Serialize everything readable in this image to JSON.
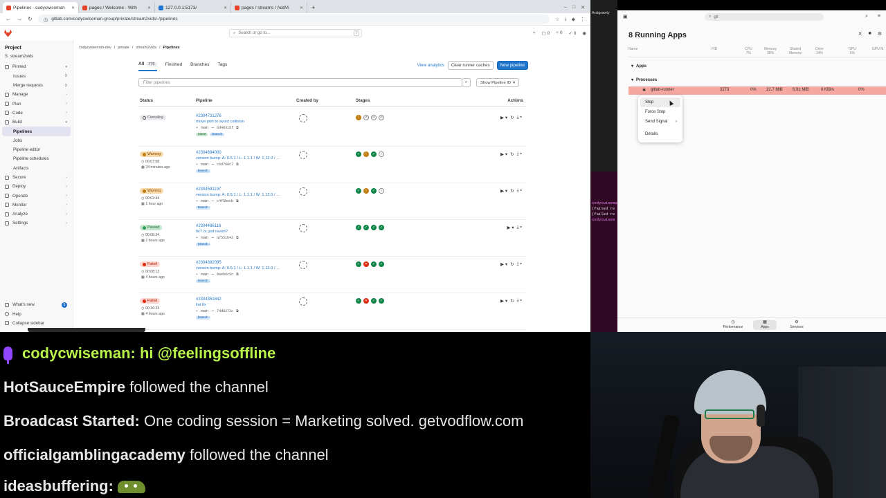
{
  "browser": {
    "tabs": [
      {
        "label": "Pipelines · codycwiseman",
        "active": true
      },
      {
        "label": "pages / Welcome · With",
        "active": false
      },
      {
        "label": "127.0.0.1:5173/",
        "active": false
      },
      {
        "label": "pages / streams / AddVi",
        "active": false
      }
    ],
    "new_tab": "+",
    "url": "gitlab.com/codycwiseman-group/private/stream2vids/-/pipelines"
  },
  "gitlab": {
    "search_placeholder": "Search or go to...",
    "search_shortcut": "/",
    "top_counts": [
      "0",
      "0",
      "0"
    ],
    "sidebar": {
      "project_label": "Project",
      "project_name": "stream2vids",
      "items": [
        {
          "label": "Pinned",
          "chevron": "▾"
        },
        {
          "label": "Issues",
          "count": "0",
          "sub": true
        },
        {
          "label": "Merge requests",
          "count": "0",
          "sub": true
        },
        {
          "label": "Manage",
          "chevron": "›"
        },
        {
          "label": "Plan",
          "chevron": "›"
        },
        {
          "label": "Code",
          "chevron": "›"
        },
        {
          "label": "Build",
          "chevron": "▾"
        },
        {
          "label": "Pipelines",
          "sub": true,
          "active": true
        },
        {
          "label": "Jobs",
          "sub": true
        },
        {
          "label": "Pipeline editor",
          "sub": true
        },
        {
          "label": "Pipeline schedules",
          "sub": true
        },
        {
          "label": "Artifacts",
          "sub": true
        },
        {
          "label": "Secure",
          "chevron": "›"
        },
        {
          "label": "Deploy",
          "chevron": "›"
        },
        {
          "label": "Operate",
          "chevron": "›"
        },
        {
          "label": "Monitor",
          "chevron": "›"
        },
        {
          "label": "Analyze",
          "chevron": "›"
        },
        {
          "label": "Settings",
          "chevron": "›"
        }
      ],
      "whats_new": "What's new",
      "whats_new_count": "5",
      "help": "Help",
      "collapse": "Collapse sidebar"
    },
    "breadcrumbs": [
      "codycwiseman-dev",
      "private",
      "stream2vids",
      "Pipelines"
    ],
    "tabs": [
      {
        "label": "All",
        "count": "776",
        "active": true
      },
      {
        "label": "Finished"
      },
      {
        "label": "Branches"
      },
      {
        "label": "Tags"
      }
    ],
    "buttons": {
      "view_analytics": "View analytics",
      "clear_cache": "Clear runner caches",
      "new_pipeline": "New pipeline",
      "show_id": "Show Pipeline ID"
    },
    "filter_placeholder": "Filter pipelines",
    "columns": [
      "Status",
      "Pipeline",
      "Created by",
      "Stages",
      "Actions"
    ],
    "pipelines": [
      {
        "status": "Canceling",
        "status_class": "st-canceling",
        "duration": "",
        "ago": "",
        "id": "#2304731276",
        "message": "move port to avoid collision",
        "ref": "main",
        "sha": "6d48315f",
        "tags": [
          "latest",
          "branch"
        ],
        "stages": [
          "warn",
          "cancel",
          "cancel",
          "cancel"
        ],
        "play": true,
        "retry": true,
        "download": true
      },
      {
        "status": "Warning",
        "status_class": "st-warning",
        "duration": "00:07:58",
        "ago": "34 minutes ago",
        "id": "#2304684000",
        "message": "version bump: A: 0.5.1 / L: 1.1.1 / W: 1.12.0 / ...",
        "ref": "main",
        "sha": "c6d760c7",
        "tags": [
          "branch"
        ],
        "stages": [
          "ok",
          "warn",
          "ok",
          "skip"
        ],
        "play": true,
        "retry": true,
        "download": true
      },
      {
        "status": "Warning",
        "status_class": "st-warning",
        "duration": "00:02:44",
        "ago": "1 hour ago",
        "id": "#2304591197",
        "message": "version bump: A: 0.5.1 / L: 1.1.1 / W: 1.12.0 / ...",
        "ref": "main",
        "sha": "c4f5becb",
        "tags": [
          "branch"
        ],
        "stages": [
          "ok",
          "warn",
          "ok",
          "skip"
        ],
        "play": true,
        "retry": true,
        "download": true
      },
      {
        "status": "Passed",
        "status_class": "st-passed",
        "duration": "00:08:34",
        "ago": "2 hours ago",
        "id": "#2304486116",
        "message": "fix? or just revert?",
        "ref": "main",
        "sha": "a7551b43",
        "tags": [
          "branch"
        ],
        "stages": [
          "ok",
          "ok",
          "ok",
          "ok"
        ],
        "play": true,
        "retry": false,
        "download": true
      },
      {
        "status": "Failed",
        "status_class": "st-failed",
        "duration": "00:08:13",
        "ago": "4 hours ago",
        "id": "#2304382095",
        "message": "version bump: A: 0.5.1 / L: 1.1.1 / W: 1.12.0 / ...",
        "ref": "main",
        "sha": "9aeb6c5c",
        "tags": [
          "branch"
        ],
        "stages": [
          "ok",
          "fail",
          "ok",
          "ok"
        ],
        "play": true,
        "retry": true,
        "download": true
      },
      {
        "status": "Failed",
        "status_class": "st-failed",
        "duration": "00:16:23",
        "ago": "4 hours ago",
        "id": "#2304351842",
        "message": "lint fix",
        "ref": "main",
        "sha": "7dd8272c",
        "tags": [
          "branch"
        ],
        "stages": [
          "ok",
          "fail",
          "ok",
          "ok"
        ],
        "play": true,
        "retry": true,
        "download": true
      }
    ]
  },
  "terminal": {
    "app_label": "Antigravity",
    "lines": [
      "codycwiseman",
      "(failed re",
      "(failed re",
      "codycwisem"
    ]
  },
  "sysmon": {
    "search_value": "git",
    "title": "8 Running Apps",
    "columns": [
      "Name",
      "PID",
      "CPU\n7%",
      "Memory\n38%",
      "Shared\nMemory",
      "Drive\n14%",
      "GPU\n6%",
      "GPU M"
    ],
    "groups": {
      "apps": "Apps",
      "processes": "Processes"
    },
    "process": {
      "name": "gitlab-runner",
      "pid": "3273",
      "cpu": "0%",
      "memory": "22.7 MiB",
      "shared": "6.91 MiB",
      "drive": "0 KiB/s",
      "gpu": "0%"
    },
    "context_menu": [
      {
        "label": "Stop",
        "hover": true
      },
      {
        "label": "Force Stop"
      },
      {
        "label": "Send Signal",
        "arrow": "›"
      },
      {
        "label": "Details"
      }
    ],
    "bottom_nav": [
      {
        "label": "Performance",
        "icon": "◷"
      },
      {
        "label": "Apps",
        "icon": "▦",
        "active": true
      },
      {
        "label": "Services",
        "icon": "⚙"
      }
    ]
  },
  "chat": {
    "messages": [
      {
        "user": "codycwiseman:",
        "text": " hi @feelingsoffline",
        "mic": true,
        "user_color": "#b8f24a",
        "text_color": "#b8f24a"
      },
      {
        "user": "HotSauceEmpire",
        "text": " followed the channel"
      },
      {
        "user": "Broadcast Started:",
        "text": " One coding session = Marketing solved. getvodflow.com"
      },
      {
        "user": "officialgamblingacademy",
        "text": " followed the channel"
      },
      {
        "user": "ideasbuffering:",
        "text": " ",
        "emote": true
      }
    ]
  },
  "colors": {
    "gitlab_blue": "#1f75cb",
    "passed": "#108548",
    "failed": "#dd2b0e",
    "warning": "#c17d10",
    "selected_row": "#f5a7a0",
    "chat_mention": "#b8f24a",
    "mic_purple": "#9146ff"
  }
}
